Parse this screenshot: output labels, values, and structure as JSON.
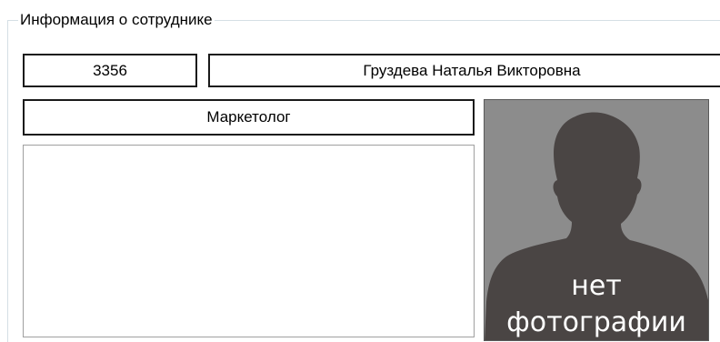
{
  "group": {
    "title": "Информация о сотруднике"
  },
  "employee": {
    "id": "3356",
    "full_name": "Груздева Наталья Викторовна",
    "position": "Маркетолог",
    "notes": ""
  },
  "photo": {
    "placeholder_line1": "нет",
    "placeholder_line2": "фотографии",
    "icon": "person-silhouette-icon"
  },
  "colors": {
    "photo_background": "#8c8c8c",
    "silhouette": "#4a4544",
    "groupbox_border": "#d5dfe5"
  }
}
